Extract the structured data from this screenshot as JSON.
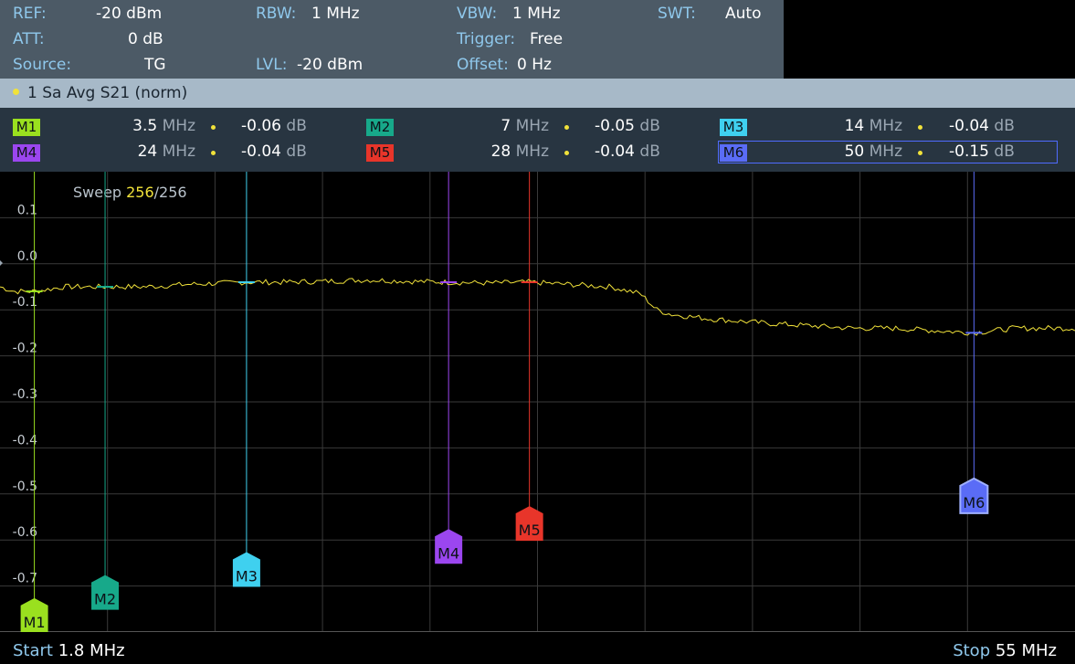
{
  "settings": {
    "ref_label": "REF:",
    "ref_value": "-20 dBm",
    "att_label": "ATT:",
    "att_value": "0 dB",
    "source_label": "Source:",
    "source_value": "TG",
    "rbw_label": "RBW:",
    "rbw_value": "1 MHz",
    "lvl_label": "LVL:",
    "lvl_value": "-20 dBm",
    "vbw_label": "VBW:",
    "vbw_value": "1 MHz",
    "trigger_label": "Trigger:",
    "trigger_value": "Free",
    "offset_label": "Offset:",
    "offset_value": "0 Hz",
    "swt_label": "SWT:",
    "swt_value": "Auto"
  },
  "trace": {
    "label": "1 Sa  Avg S21 (norm)",
    "color": "#f1e23a"
  },
  "markers": [
    {
      "name": "M1",
      "freq_num": "3.5",
      "freq_unit": "MHz",
      "val_num": "-0.06",
      "val_unit": "dB",
      "color": "#9ae01f"
    },
    {
      "name": "M2",
      "freq_num": "7",
      "freq_unit": "MHz",
      "val_num": "-0.05",
      "val_unit": "dB",
      "color": "#17a98a"
    },
    {
      "name": "M3",
      "freq_num": "14",
      "freq_unit": "MHz",
      "val_num": "-0.04",
      "val_unit": "dB",
      "color": "#3fd0ef"
    },
    {
      "name": "M4",
      "freq_num": "24",
      "freq_unit": "MHz",
      "val_num": "-0.04",
      "val_unit": "dB",
      "color": "#9b46ef"
    },
    {
      "name": "M5",
      "freq_num": "28",
      "freq_unit": "MHz",
      "val_num": "-0.04",
      "val_unit": "dB",
      "color": "#e8352a"
    },
    {
      "name": "M6",
      "freq_num": "50",
      "freq_unit": "MHz",
      "val_num": "-0.15",
      "val_unit": "dB",
      "color": "#5a6cf6",
      "selected": true
    }
  ],
  "sweep": {
    "label": "Sweep",
    "current": "256",
    "sep": "/",
    "total": "256"
  },
  "footer": {
    "start_label": "Start",
    "start_value": "1.8 MHz",
    "stop_label": "Stop",
    "stop_value": "55 MHz"
  },
  "chart_data": {
    "type": "line",
    "ylabel": "",
    "xlabel": "",
    "x_unit": "MHz",
    "xlim": [
      1.8,
      55
    ],
    "ylim": [
      -0.8,
      0.2
    ],
    "y_ticks": [
      0.1,
      0.0,
      -0.1,
      -0.2,
      -0.3,
      -0.4,
      -0.5,
      -0.6,
      -0.7
    ],
    "y_tick_labels": [
      "0.1",
      "0.0",
      "-0.1",
      "-0.2",
      "-0.3",
      "-0.4",
      "-0.5",
      "-0.6",
      "-0.7"
    ],
    "grid": true,
    "series": [
      {
        "color": "#f1e23a",
        "x": [
          1.8,
          2.5,
          3.5,
          5,
          7,
          9,
          11,
          14,
          16,
          18,
          20,
          22,
          24,
          26,
          28,
          30,
          32,
          33.5,
          34.3,
          35,
          37,
          40,
          42,
          44,
          46,
          48,
          50,
          52,
          55
        ],
        "y": [
          -0.05,
          -0.06,
          -0.06,
          -0.05,
          -0.05,
          -0.05,
          -0.045,
          -0.04,
          -0.04,
          -0.038,
          -0.035,
          -0.038,
          -0.04,
          -0.042,
          -0.04,
          -0.045,
          -0.05,
          -0.065,
          -0.1,
          -0.11,
          -0.12,
          -0.13,
          -0.135,
          -0.14,
          -0.14,
          -0.145,
          -0.15,
          -0.14,
          -0.14
        ]
      }
    ],
    "markers": [
      {
        "name": "M1",
        "x": 3.5,
        "y": -0.06
      },
      {
        "name": "M2",
        "x": 7,
        "y": -0.05
      },
      {
        "name": "M3",
        "x": 14,
        "y": -0.04
      },
      {
        "name": "M4",
        "x": 24,
        "y": -0.04
      },
      {
        "name": "M5",
        "x": 28,
        "y": -0.04
      },
      {
        "name": "M6",
        "x": 50,
        "y": -0.15
      }
    ],
    "marker_badge_levels": [
      -0.77,
      -0.72,
      -0.67,
      -0.62,
      -0.57,
      -0.51
    ]
  }
}
